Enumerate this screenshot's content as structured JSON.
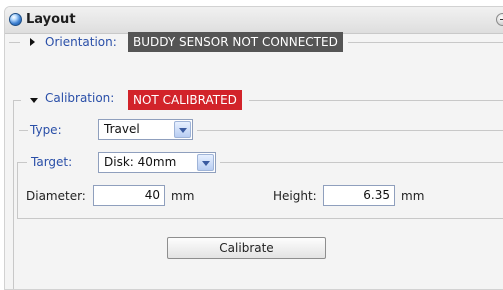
{
  "panel": {
    "title": "Layout"
  },
  "orientation": {
    "label": "Orientation:",
    "status": "BUDDY SENSOR NOT CONNECTED",
    "status_color": "#555555"
  },
  "calibration": {
    "label": "Calibration:",
    "status": "NOT CALIBRATED",
    "status_color": "#d2232a",
    "type": {
      "label": "Type:",
      "selected": "Travel"
    },
    "target": {
      "label": "Target:",
      "selected": "Disk: 40mm"
    },
    "diameter": {
      "label": "Diameter:",
      "value": "40",
      "unit": "mm"
    },
    "height": {
      "label": "Height:",
      "value": "6.35",
      "unit": "mm"
    },
    "calibrate_button": "Calibrate"
  }
}
